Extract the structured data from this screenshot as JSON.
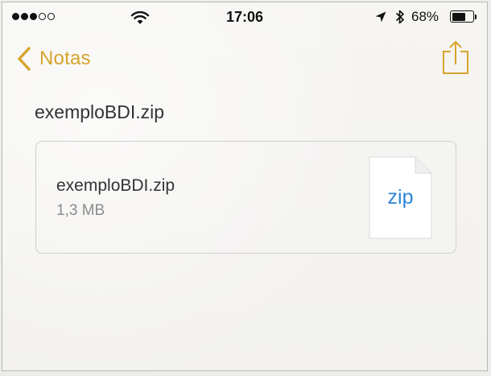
{
  "status_bar": {
    "signal_dots_filled": 3,
    "signal_dots_total": 5,
    "time": "17:06",
    "battery_percent": "68%",
    "battery_level": 0.68,
    "icons": [
      "wifi-icon",
      "location-arrow-icon",
      "bluetooth-icon",
      "battery-icon"
    ]
  },
  "nav": {
    "back_label": "Notas",
    "back_icon": "chevron-left-icon",
    "share_icon": "share-icon",
    "accent_color": "#d6a42c"
  },
  "attachment": {
    "title": "exemploBDI.zip",
    "file_name": "exemploBDI.zip",
    "file_size": "1,3 MB",
    "file_type_label": "zip",
    "file_type_color": "#2f86d8",
    "file_icon": "document-icon"
  }
}
